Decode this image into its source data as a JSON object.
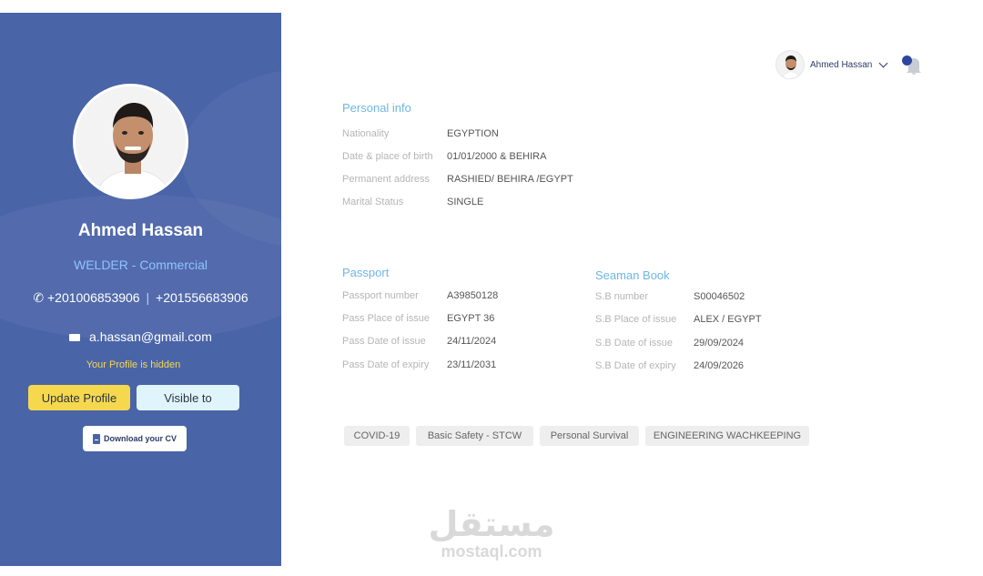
{
  "profile": {
    "name": "Ahmed Hassan",
    "role": "WELDER - Commercial",
    "phone1": "+201006853906",
    "phone_sep": "|",
    "phone2": "+201556683906",
    "email": "a.hassan@gmail.com",
    "hidden_note": "Your Profile is hidden",
    "update_label": "Update Profile",
    "visible_label": "Visible to",
    "download_label": "Download your CV"
  },
  "header": {
    "user_name": "Ahmed Hassan"
  },
  "personal": {
    "title": "Personal info",
    "rows": [
      {
        "label": "Nationality",
        "value": "EGYPTION"
      },
      {
        "label": "Date & place of birth",
        "value": "01/01/2000 & BEHIRA"
      },
      {
        "label": "Permanent address",
        "value": "RASHIED/ BEHIRA /EGYPT"
      },
      {
        "label": "Marital Status",
        "value": "SINGLE"
      }
    ]
  },
  "passport": {
    "title": "Passport",
    "rows": [
      {
        "label": "Passport number",
        "value": "A39850128"
      },
      {
        "label": "Pass Place of issue",
        "value": "EGYPT 36"
      },
      {
        "label": "Pass Date of issue",
        "value": "24/11/2024"
      },
      {
        "label": "Pass Date of expiry",
        "value": "23/11/2031"
      }
    ]
  },
  "seaman": {
    "title": "Seaman Book",
    "rows": [
      {
        "label": "S.B number",
        "value": "S00046502"
      },
      {
        "label": "S.B Place of issue",
        "value": "ALEX / EGYPT"
      },
      {
        "label": "S.B Date of issue",
        "value": "29/09/2024"
      },
      {
        "label": "S.B Date of expiry",
        "value": "24/09/2026"
      }
    ]
  },
  "tags": [
    "COVID-19",
    "Basic Safety - STCW",
    "Personal Survival",
    "ENGINEERING WACHKEEPING"
  ],
  "watermark": {
    "arabic": "مستقل",
    "latin": "mostaql.com"
  },
  "colors": {
    "sidebar": "#4a64a8",
    "accent_yellow": "#f5d84e",
    "section_title": "#6fb6e4"
  }
}
